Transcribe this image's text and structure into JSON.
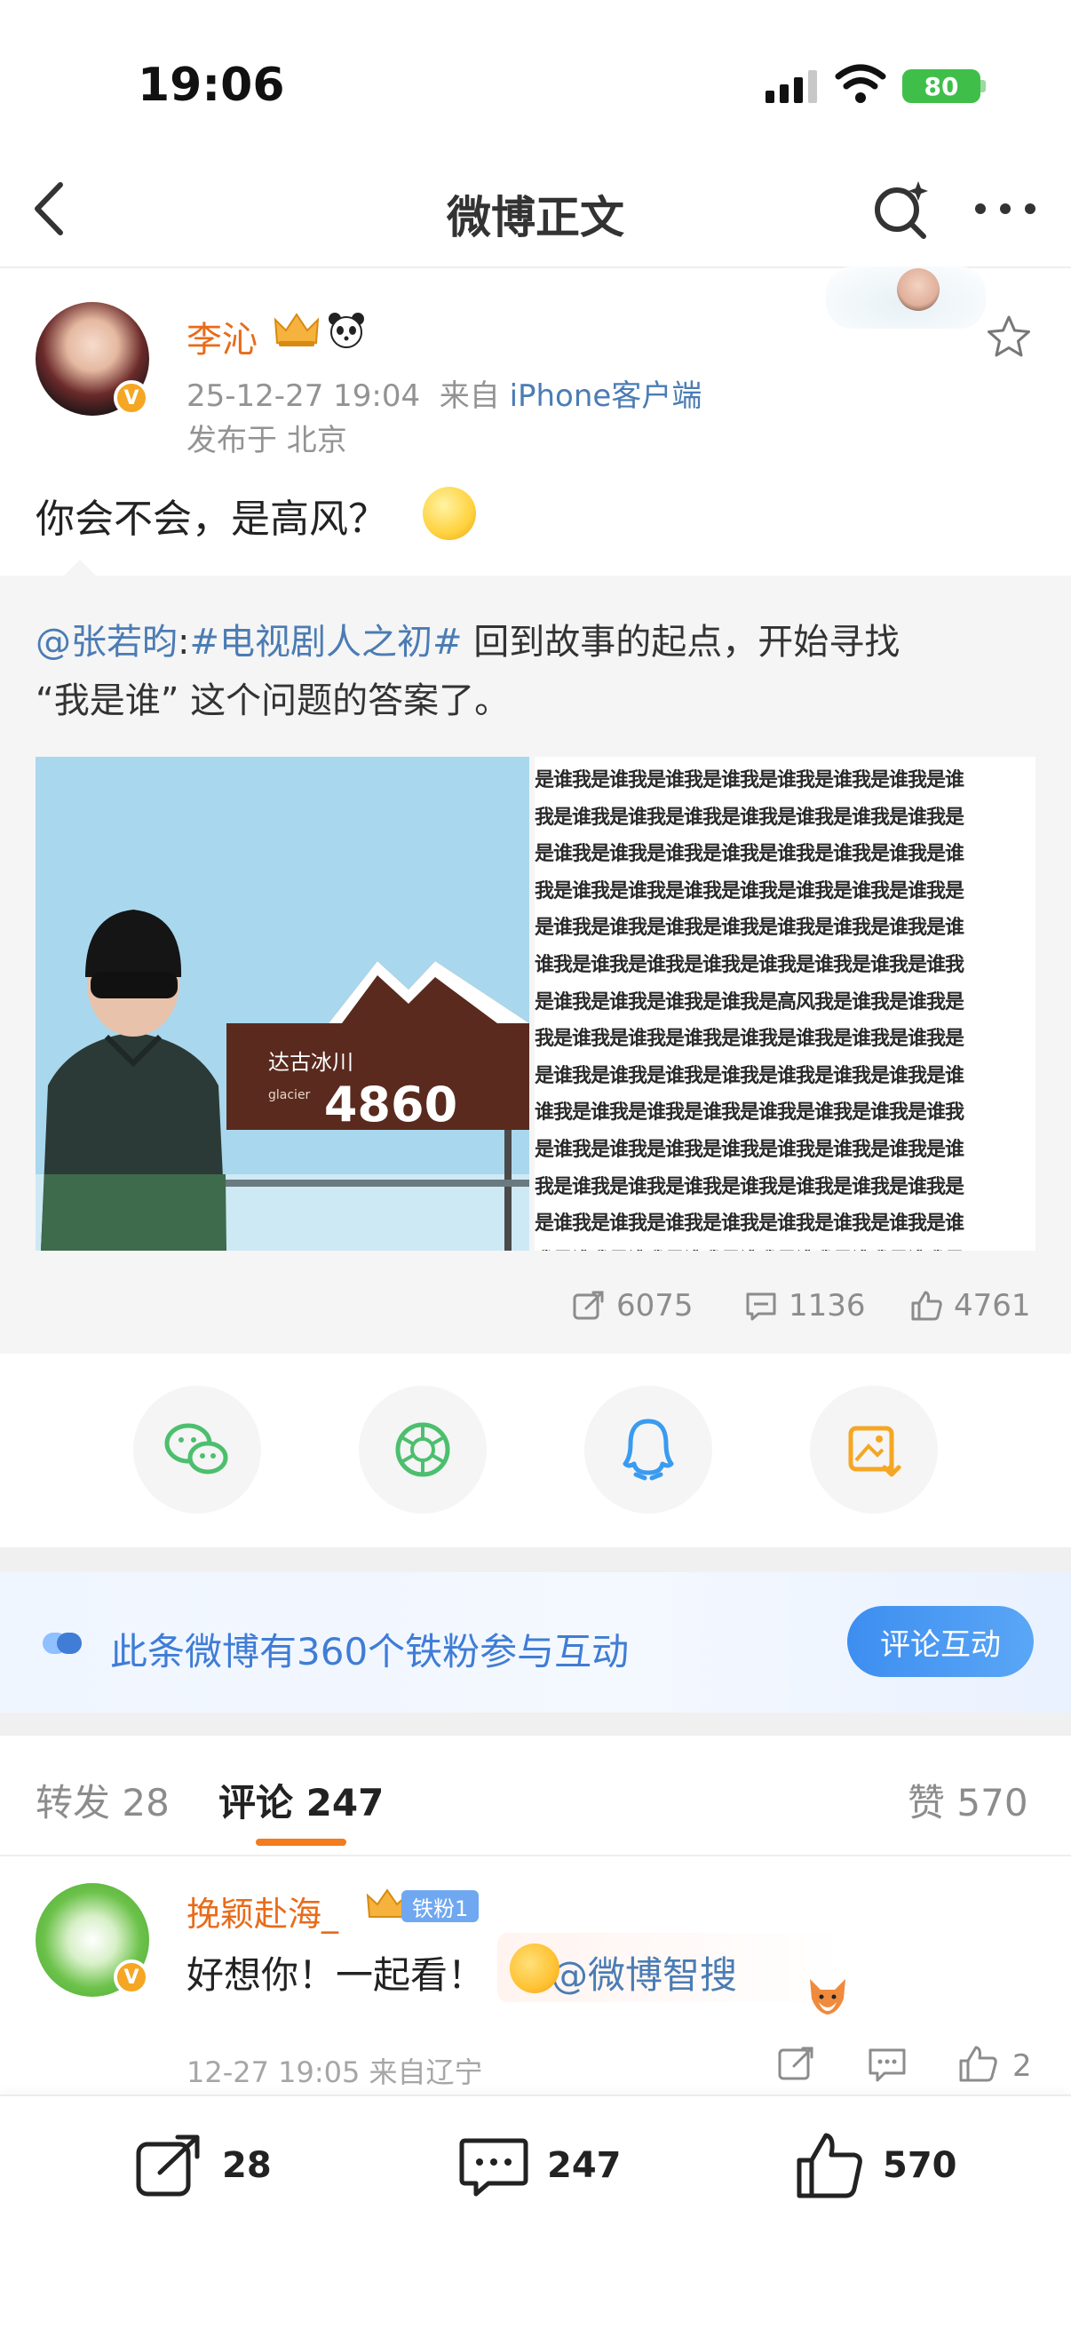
{
  "status_bar": {
    "time": "19:06",
    "battery": "80"
  },
  "nav": {
    "title": "微博正文"
  },
  "author": {
    "name": "李沁",
    "time": "25-12-27 19:04",
    "source_prefix": "来自",
    "source": "iPhone客户端",
    "location": "发布于 北京"
  },
  "post": {
    "text": "你会不会，是高风？"
  },
  "retweet": {
    "mention": "@张若昀",
    "colon": ":",
    "topic": "#电视剧人之初#",
    "text_a": " 回到故事的起点，开始寻找",
    "text_b": "“我是谁” 这个问题的答案了。",
    "photo1_sign_number": "4860",
    "photo1_sign_text": "达古冰川",
    "photo1_sign_en": "glacier",
    "photo2_lines": [
      "是谁我是谁我是谁我是谁我是谁我是谁我是谁我是谁",
      "我是谁我是谁我是谁我是谁我是谁我是谁我是谁我是",
      "是谁我是谁我是谁我是谁我是谁我是谁我是谁我是谁",
      "我是谁我是谁我是谁我是谁我是谁我是谁我是谁我是",
      "是谁我是谁我是谁我是谁我是谁我是谁我是谁我是谁",
      "谁我是谁我是谁我是谁我是谁我是谁我是谁我是谁我",
      "是谁我是谁我是谁我是谁我是高风我是谁我是谁我是",
      "我是谁我是谁我是谁我是谁我是谁我是谁我是谁我是",
      "是谁我是谁我是谁我是谁我是谁我是谁我是谁我是谁",
      "谁我是谁我是谁我是谁我是谁我是谁我是谁我是谁我",
      "是谁我是谁我是谁我是谁我是谁我是谁我是谁我是谁",
      "我是谁我是谁我是谁我是谁我是谁我是谁我是谁我是",
      "是谁我是谁我是谁我是谁我是谁我是谁我是谁我是谁",
      "我是谁我是谁我是谁我是谁我是谁我是谁我是谁我是"
    ],
    "repost_count": "6075",
    "comment_count": "1136",
    "like_count": "4761"
  },
  "fans_banner": {
    "text": "此条微博有360个铁粉参与互动",
    "button": "评论互动"
  },
  "tabs": {
    "repost_label": "转发",
    "repost_count": "28",
    "comment_label": "评论",
    "comment_count": "247",
    "like_label": "赞",
    "like_count": "570"
  },
  "comment": {
    "name": "挽颖赴海_",
    "badge": "铁粉1",
    "text": "好想你！一起看！",
    "mention": "@微博智搜",
    "meta": "12-27 19:05  来自辽宁",
    "likes": "2"
  },
  "bottom_bar": {
    "repost": "28",
    "comment": "247",
    "like": "570"
  },
  "colors": {
    "accent_orange": "#e86b1a",
    "link_blue": "#4b7cb4",
    "fans_blue": "#3f7dd6"
  }
}
